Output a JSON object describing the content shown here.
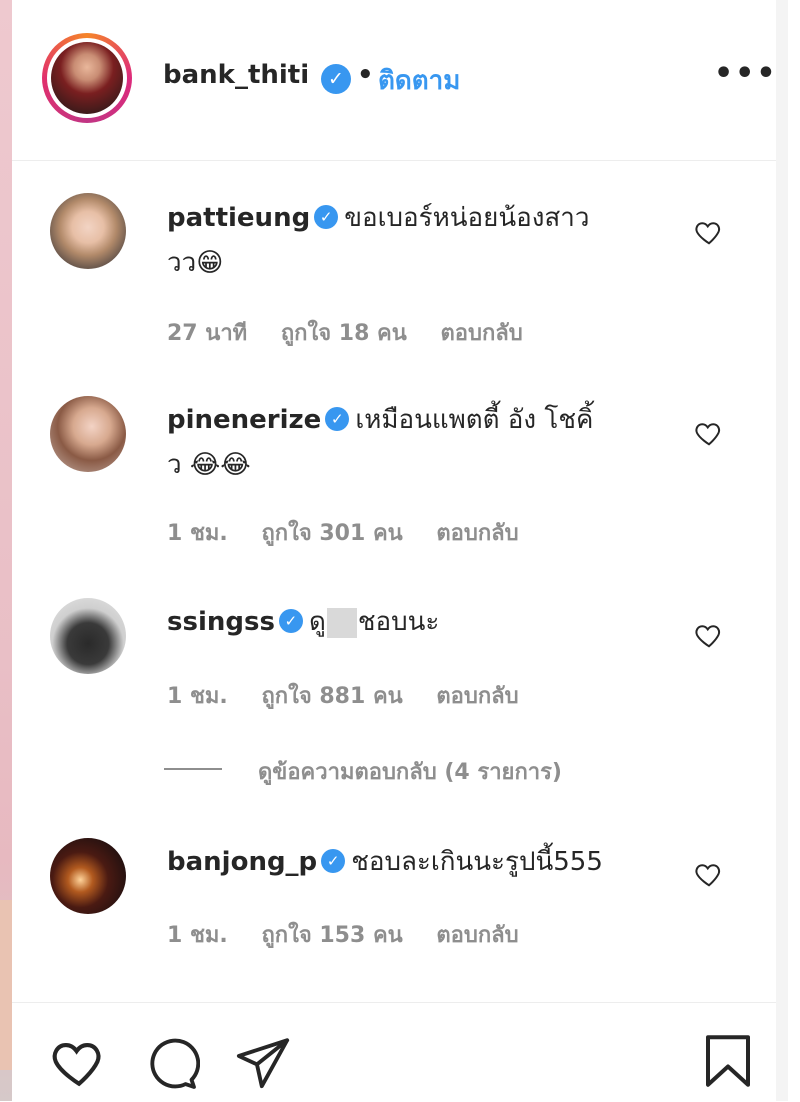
{
  "post": {
    "header": {
      "username": "bank_thiti",
      "verified_icon": "verified-badge-icon",
      "separator": "•",
      "follow_label": "ติดตาม",
      "more_icon": "more-options-icon",
      "more_glyph": "•••"
    },
    "comments": [
      {
        "username": "pattieung",
        "text_line1": "ขอเบอร์หน่อยน้องสาว",
        "text_line2": "วว😁",
        "time": "27 นาที",
        "likes": "ถูกใจ 18 คน",
        "reply": "ตอบกลับ"
      },
      {
        "username": "pinenerize",
        "text_line1": "เหมือนแพตตี้ อัง โชคิ้",
        "text_line2": "ว 😂😂",
        "time": "1 ชม.",
        "likes": "ถูกใจ 301 คน",
        "reply": "ตอบกลับ"
      },
      {
        "username": "ssingss",
        "text_part1": "ดู",
        "text_part2": "ชอบนะ",
        "time": "1 ชม.",
        "likes": "ถูกใจ 881 คน",
        "reply": "ตอบกลับ"
      },
      {
        "username": "banjong_p",
        "text_line1": "ชอบละเกินนะรูปนี้555",
        "time": "1 ชม.",
        "likes": "ถูกใจ 153 คน",
        "reply": "ตอบกลับ"
      }
    ],
    "view_replies": "ดูข้อความตอบกลับ (4 รายการ)",
    "action_icons": [
      "heart-icon",
      "comment-icon",
      "share-icon",
      "bookmark-icon"
    ],
    "colors": {
      "link": "#3897f0",
      "text": "#262626",
      "meta": "#8e8e8e"
    }
  }
}
